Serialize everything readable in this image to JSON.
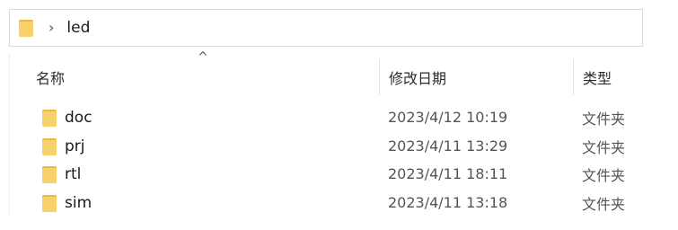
{
  "address": {
    "icon": "folder-icon",
    "separator": "›",
    "path": "led"
  },
  "columns": {
    "name": "名称",
    "date": "修改日期",
    "type": "类型"
  },
  "sort_indicator": "^",
  "rows": [
    {
      "name": "doc",
      "date": "2023/4/12 10:19",
      "type": "文件夹",
      "icon": "folder-icon"
    },
    {
      "name": "prj",
      "date": "2023/4/11 13:29",
      "type": "文件夹",
      "icon": "folder-icon"
    },
    {
      "name": "rtl",
      "date": "2023/4/11 18:11",
      "type": "文件夹",
      "icon": "folder-icon"
    },
    {
      "name": "sim",
      "date": "2023/4/11 13:18",
      "type": "文件夹",
      "icon": "folder-icon"
    }
  ],
  "colors": {
    "folder_fill": "#F6D36A",
    "folder_shade": "#E6B94A"
  }
}
